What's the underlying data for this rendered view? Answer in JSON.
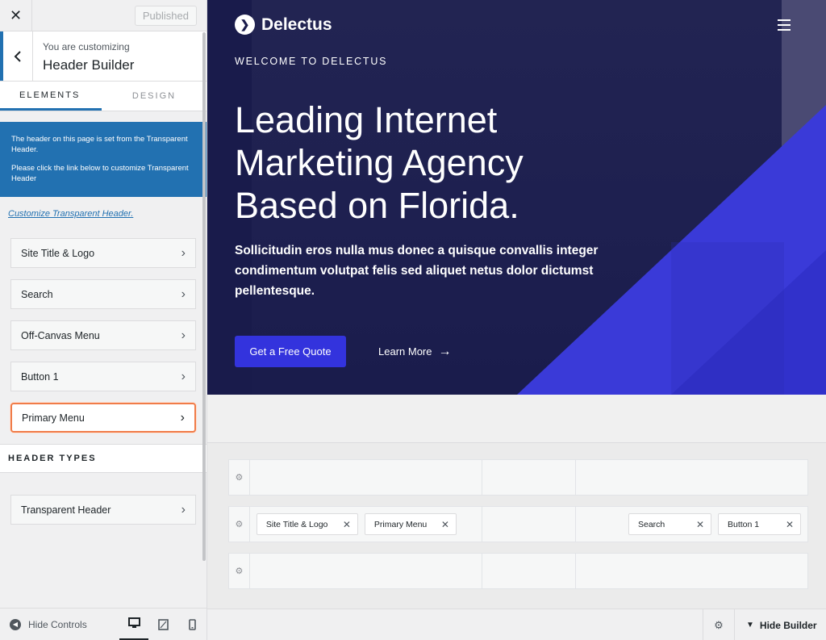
{
  "sidebar": {
    "close_label": "✕",
    "published_label": "Published",
    "heading_sub": "You are customizing",
    "heading_title": "Header Builder",
    "tabs": [
      {
        "label": "ELEMENTS",
        "active": true
      },
      {
        "label": "DESIGN",
        "active": false
      }
    ],
    "notice": {
      "line1": "The header on this page is set from the Transparent Header.",
      "line2": "Please click the link below to customize Transparent Header"
    },
    "notice_link": "Customize Transparent Header.",
    "items": [
      {
        "label": "Site Title & Logo"
      },
      {
        "label": "Search"
      },
      {
        "label": "Off-Canvas Menu"
      },
      {
        "label": "Button 1"
      },
      {
        "label": "Primary Menu",
        "highlighted": true
      }
    ],
    "section_title": "HEADER TYPES",
    "types": [
      {
        "label": "Transparent Header"
      }
    ],
    "footer": {
      "hide_controls": "Hide Controls",
      "devices": [
        "desktop-icon",
        "tablet-icon",
        "mobile-icon"
      ],
      "active_device": "desktop"
    }
  },
  "hero": {
    "brand": "Delectus",
    "kicker": "WELCOME TO DELECTUS",
    "title": "Leading Internet Marketing Agency Based on Florida.",
    "subtitle": "Sollicitudin eros nulla mus donec a quisque convallis integer condimentum volutpat felis sed aliquet netus dolor dictumst pellentesque.",
    "cta_primary": "Get a Free Quote",
    "cta_secondary": "Learn More"
  },
  "builder": {
    "rows": [
      {
        "left": [],
        "center": [],
        "right": []
      },
      {
        "left": [
          "Site Title & Logo",
          "Primary Menu"
        ],
        "center": [],
        "right": [
          "Search",
          "Button 1"
        ]
      },
      {
        "left": [],
        "center": [],
        "right": []
      }
    ],
    "chips": {
      "site_title": "Site Title & Logo",
      "primary_menu": "Primary Menu",
      "search": "Search",
      "button1": "Button 1"
    },
    "hide_builder": "Hide Builder"
  },
  "colors": {
    "accent": "#2271b1",
    "hero_bg": "#191b4b",
    "hero_blue": "#3333dd",
    "highlight_border": "#f07c49"
  }
}
